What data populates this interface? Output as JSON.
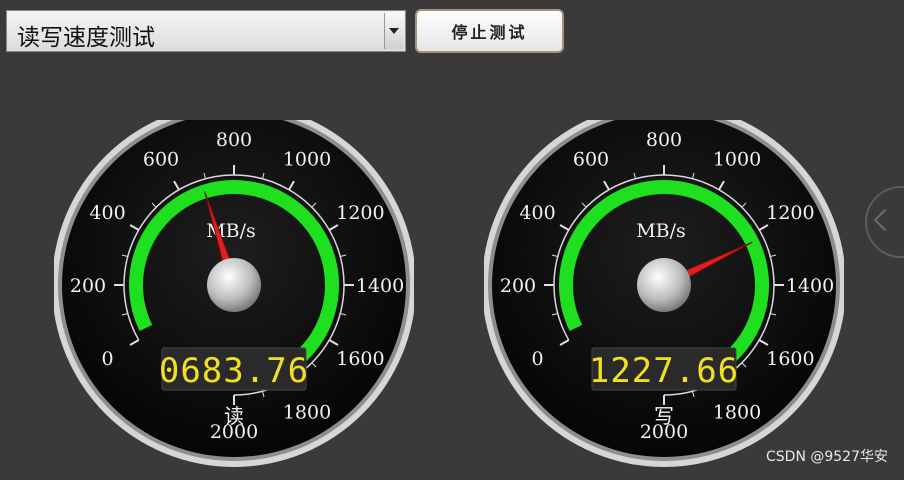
{
  "toolbar": {
    "test_mode": "读写速度测试",
    "stop_label": "停止测试"
  },
  "gauges": [
    {
      "unit": "MB/s",
      "value": 683.76,
      "display": "0683.76",
      "label": "读",
      "ticks": [
        "0",
        "200",
        "400",
        "600",
        "800",
        "1000",
        "1200",
        "1400",
        "1600",
        "1800",
        "2000"
      ],
      "min": 0,
      "max": 2000
    },
    {
      "unit": "MB/s",
      "value": 1227.66,
      "display": "1227.66",
      "label": "写",
      "ticks": [
        "0",
        "200",
        "400",
        "600",
        "800",
        "1000",
        "1200",
        "1400",
        "1600",
        "1800",
        "2000"
      ],
      "min": 0,
      "max": 2000
    }
  ],
  "colors": {
    "arc": "#1ee01e",
    "needle": "#e02020",
    "digits": "#f0e020"
  },
  "watermark": "CSDN @9527华安"
}
